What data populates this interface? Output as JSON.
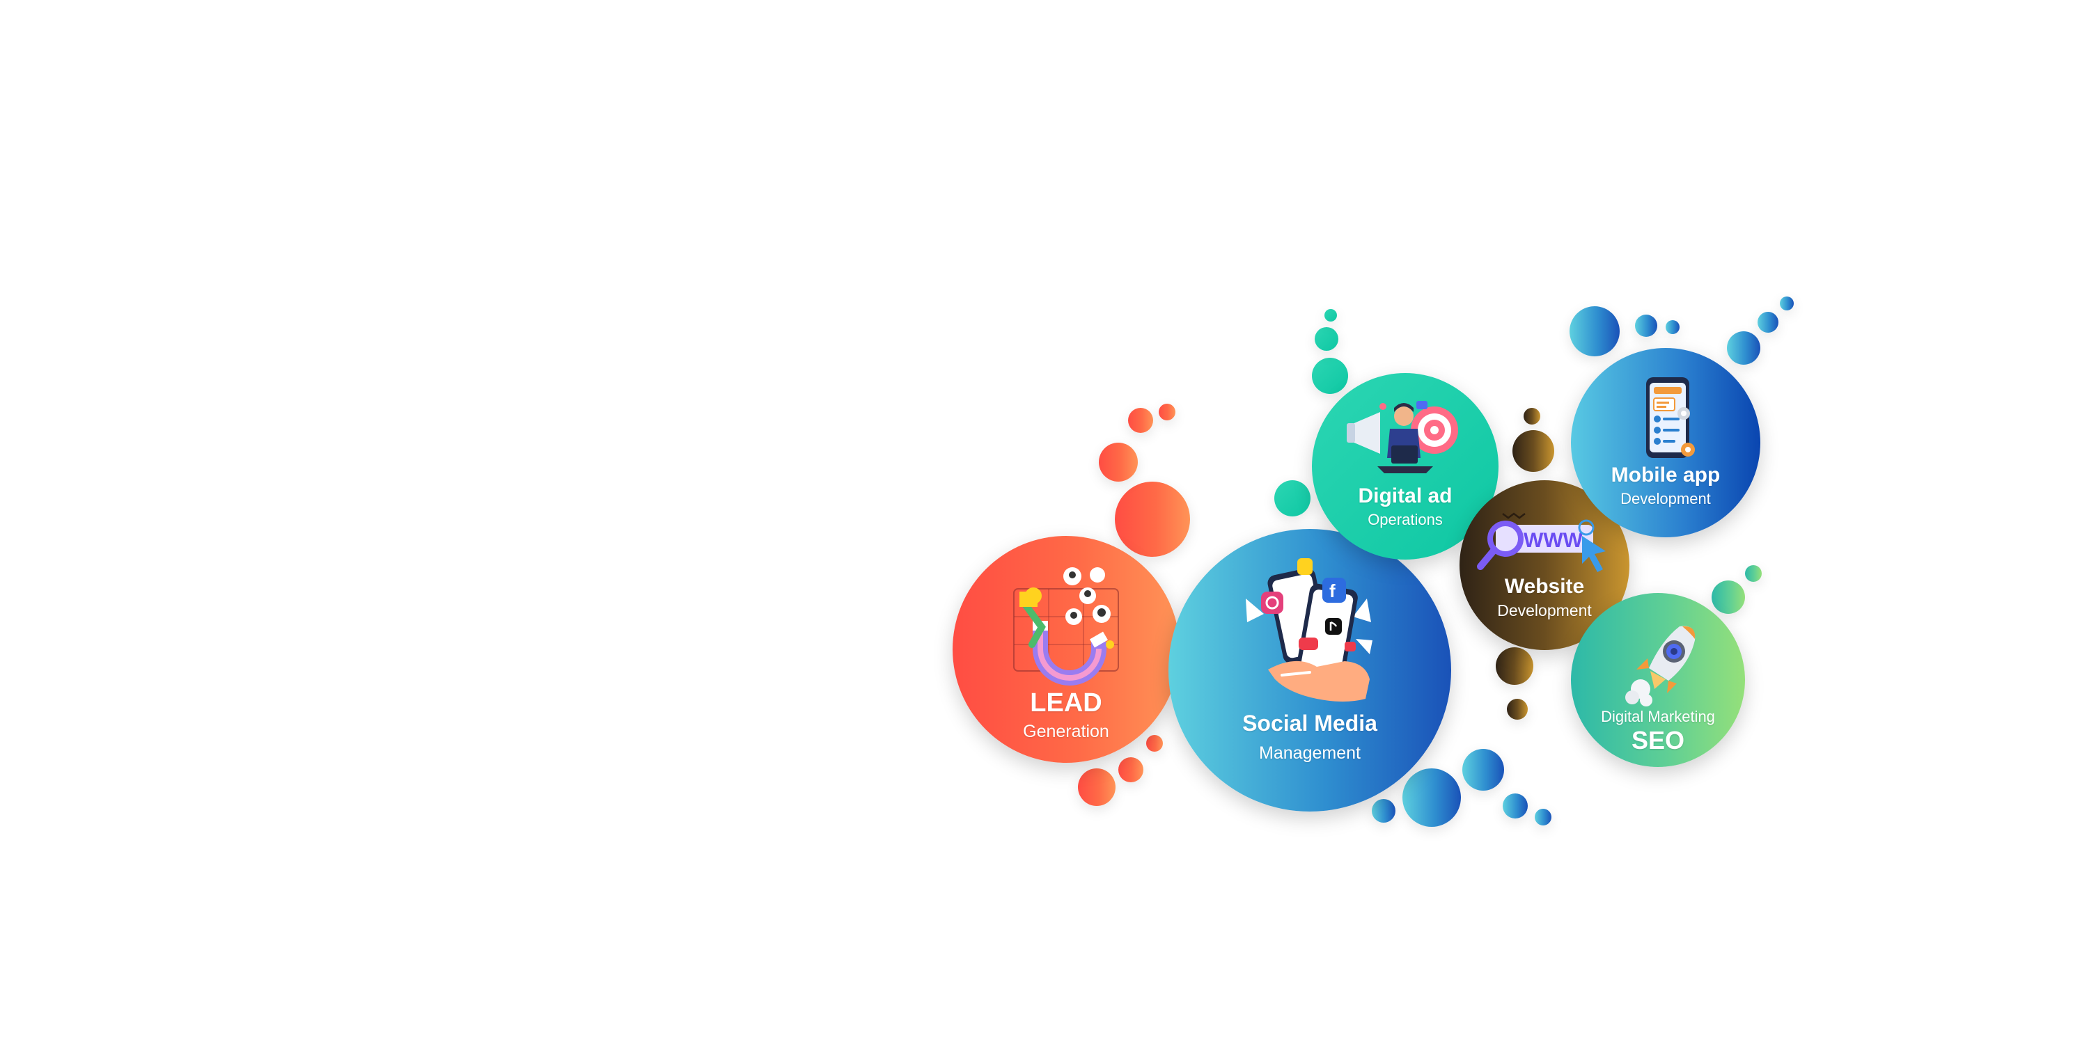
{
  "services": {
    "lead": {
      "title": "LEAD",
      "subtitle": "Generation",
      "color": "#ff5a45"
    },
    "social": {
      "title": "Social Media",
      "subtitle": "Management",
      "color": "#2f8fd0"
    },
    "digital_ad": {
      "title": "Digital ad",
      "subtitle": "Operations",
      "color": "#12c9a5"
    },
    "website": {
      "title": "Website",
      "subtitle": "Development",
      "color": "#8a6424"
    },
    "mobile": {
      "title": "Mobile app",
      "subtitle": "Development",
      "color": "#1f6cc8"
    },
    "seo": {
      "title": "SEO",
      "subtitle": "Digital Marketing",
      "color": "#5fcf95"
    }
  },
  "illustrations": {
    "lead": "magnet-icon",
    "social": "smartphone-social-icon",
    "digital_ad": "megaphone-target-icon",
    "website": "www-search-icon",
    "mobile": "mobile-app-icon",
    "seo": "rocket-icon"
  },
  "illustration_text": {
    "www": "WWW"
  }
}
